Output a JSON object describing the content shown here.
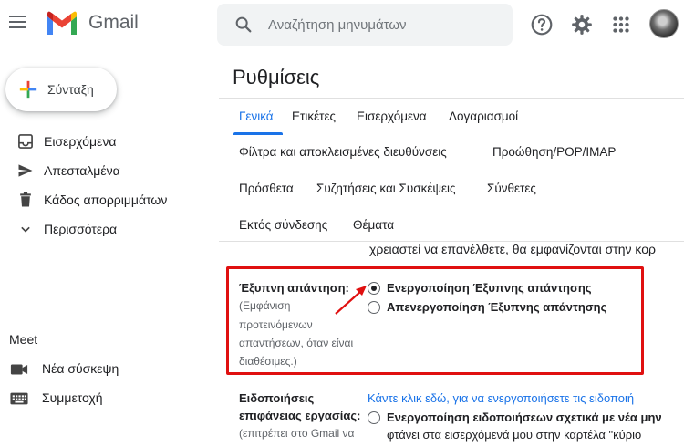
{
  "header": {
    "brand": "Gmail",
    "search_placeholder": "Αναζήτηση μηνυμάτων"
  },
  "sidebar": {
    "compose_label": "Σύνταξη",
    "items": [
      {
        "label": "Εισερχόμενα",
        "icon": "inbox-icon"
      },
      {
        "label": "Απεσταλμένα",
        "icon": "send-icon"
      },
      {
        "label": "Κάδος απορριμμάτων",
        "icon": "trash-icon"
      },
      {
        "label": "Περισσότερα",
        "icon": "chevron-down-icon"
      }
    ],
    "meet": {
      "title": "Meet",
      "items": [
        {
          "label": "Νέα σύσκεψη",
          "icon": "video-icon"
        },
        {
          "label": "Συμμετοχή",
          "icon": "keyboard-icon"
        }
      ]
    }
  },
  "settings": {
    "title": "Ρυθμίσεις",
    "tabs_row1": [
      "Γενικά",
      "Ετικέτες",
      "Εισερχόμενα",
      "Λογαριασμοί"
    ],
    "tabs_row2": [
      "Φίλτρα και αποκλεισμένες διευθύνσεις",
      "Προώθηση/POP/IMAP"
    ],
    "tabs_row3": [
      "Πρόσθετα",
      "Συζητήσεις και Συσκέψεις",
      "Σύνθετες"
    ],
    "tabs_row4": [
      "Εκτός σύνδεσης",
      "Θέματα"
    ],
    "previous_text": "χρειαστεί να επανέλθετε, θα εμφανίζονται στην κορ",
    "smart_reply": {
      "label": "Έξυπνη απάντηση:",
      "description": [
        "(Εμφάνιση",
        "προτεινόμενων",
        "απαντήσεων, όταν είναι",
        "διαθέσιμες.)"
      ],
      "option_on": "Ενεργοποίηση Έξυπνης απάντησης",
      "option_off": "Απενεργοποίηση Έξυπνης απάντησης",
      "selected": "on"
    },
    "desktop_notifications": {
      "label_line1": "Ειδοποιήσεις",
      "label_line2": "επιφάνειας εργασίας:",
      "description": "(επιτρέπει στο Gmail να",
      "link": "Κάντε κλικ εδώ, για να ενεργοποιήσετε τις ειδοποιή",
      "option_on": "Ενεργοποίηση ειδοποιήσεων σχετικά με νέα μην",
      "option_on_cont": "φτάνει στα εισερχόμενά μου στην καρτέλα \"κύριο"
    }
  },
  "colors": {
    "accent": "#1a73e8",
    "highlight": "#e01010"
  }
}
